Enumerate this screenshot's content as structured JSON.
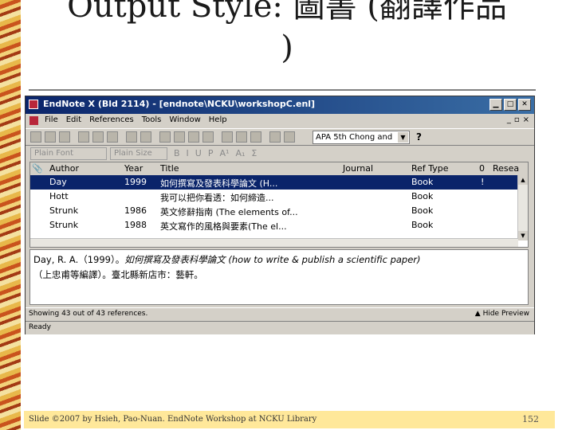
{
  "slide": {
    "title_line1": "Output Style: 圖書 (翻譯作品",
    "title_line2": ")"
  },
  "window": {
    "title": "EndNote X (Bld 2114) - [endnote\\NCKU\\workshopC.enl]",
    "menus": [
      "File",
      "Edit",
      "References",
      "Tools",
      "Window",
      "Help"
    ],
    "output_style": "APA 5th Chong and",
    "help_label": "?",
    "font_placeholder": "Plain Font",
    "size_placeholder": "Plain Size",
    "format_buttons": [
      "B",
      "I",
      "U",
      "P",
      "A¹",
      "A₁",
      "Σ"
    ]
  },
  "table": {
    "columns": [
      "Author",
      "Year",
      "Title",
      "Journal",
      "Ref Type",
      "0",
      "Resea"
    ],
    "rows": [
      {
        "author": "Day",
        "year": "1999",
        "title": "如何撰寫及發表科學論文 (H...",
        "journal": "",
        "ref_type": "Book",
        "flag": "!",
        "selected": true
      },
      {
        "author": "Hott",
        "year": "",
        "title": "我可以把你看透：如何締造...",
        "journal": "",
        "ref_type": "Book",
        "flag": "",
        "selected": false
      },
      {
        "author": "Strunk",
        "year": "1986",
        "title": "英文修辭指南 (The elements of...",
        "journal": "",
        "ref_type": "Book",
        "flag": "",
        "selected": false
      },
      {
        "author": "Strunk",
        "year": "1988",
        "title": "英文寫作的風格與要素(The el...",
        "journal": "",
        "ref_type": "Book",
        "flag": "",
        "selected": false
      }
    ]
  },
  "preview": {
    "part1": "Day, R. A.（1999）。",
    "part2": "如何撰寫及發表科學論文 (how to write & publish a scientific paper)",
    "part3": "（上忠甫等編譯）。臺北縣新店市：藝軒。"
  },
  "status": {
    "showing": "Showing 43 out of 43 references.",
    "preview_btn": "Hide Preview",
    "ready": "Ready"
  },
  "footer": {
    "text": "Slide ©2007 by Hsieh, Pao-Nuan. EndNote Workshop at NCKU Library",
    "page": "152"
  }
}
